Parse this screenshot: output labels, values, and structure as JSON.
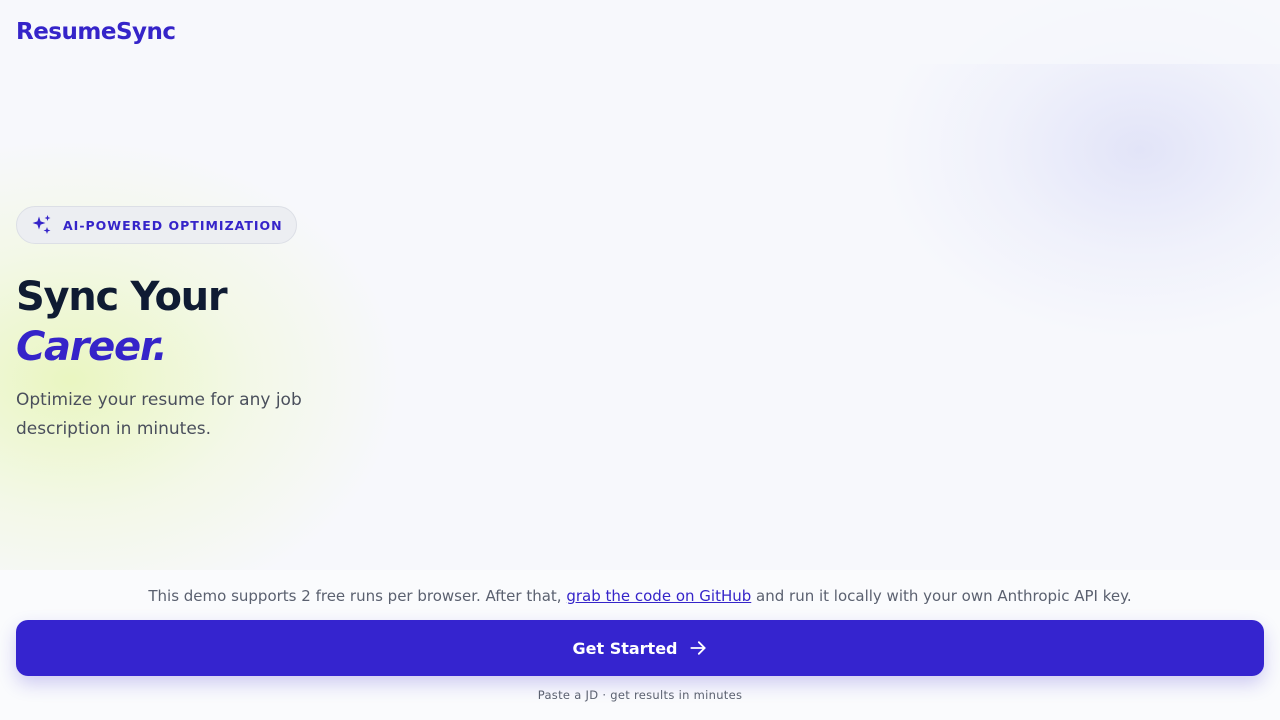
{
  "app": {
    "name": "ResumeSync"
  },
  "hero": {
    "badge": {
      "icon": "sparkles-icon",
      "label": "AI-POWERED OPTIMIZATION"
    },
    "headline_line1": "Sync Your",
    "headline_line2": "Career.",
    "subtext": "Optimize your resume for any job description in minutes."
  },
  "footer": {
    "notice_before": "This demo supports 2 free runs per browser. After that, ",
    "notice_link": "grab the code on GitHub",
    "notice_after": " and run it locally with your own Anthropic API key.",
    "cta_label": "Get Started",
    "cta_icon": "arrow-right-icon",
    "hint": "Paste a JD · get results in minutes"
  },
  "colors": {
    "brand": "#3524c9",
    "cta_background": "#3524cf",
    "heading": "#0f1b33",
    "body_text": "#4a4f5c",
    "page_background": "#f7f8fc"
  }
}
